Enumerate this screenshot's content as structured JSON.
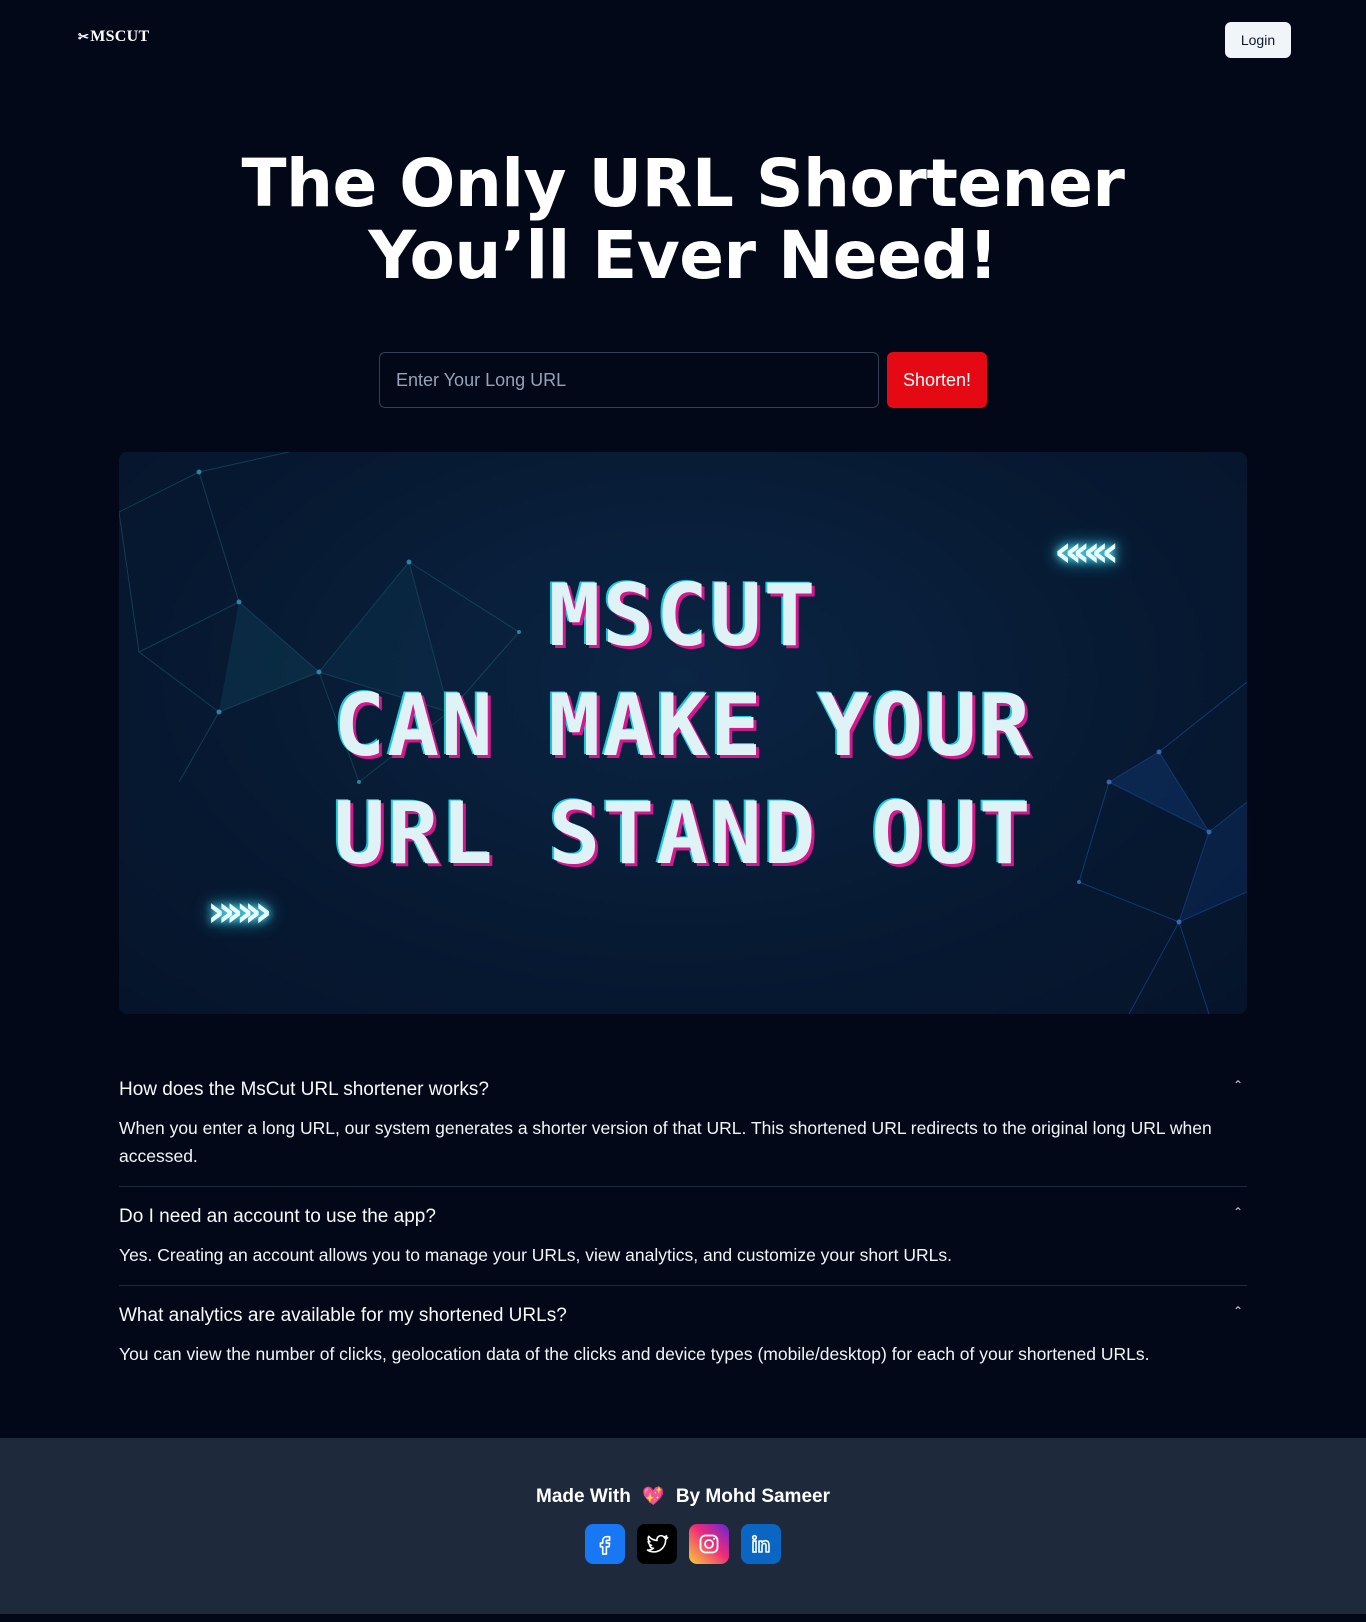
{
  "header": {
    "logo_icon": "scissors-icon",
    "logo_text": "MSCUT",
    "login_label": "Login"
  },
  "hero": {
    "title_line1": "The Only URL Shortener",
    "title_line2": "You’ll Ever Need!"
  },
  "shorten": {
    "placeholder": "Enter Your Long URL",
    "value": "",
    "button_label": "Shorten!"
  },
  "banner": {
    "line1": "MSCUT",
    "line2": "CAN MAKE YOUR",
    "line3": "URL STAND OUT",
    "chevrons_left": "«««",
    "chevrons_right": "»»»"
  },
  "faq": [
    {
      "question": "How does the MsCut URL shortener works?",
      "answer": "When you enter a long URL, our system generates a shorter version of that URL. This shortened URL redirects to the original long URL when accessed."
    },
    {
      "question": "Do I need an account to use the app?",
      "answer": "Yes. Creating an account allows you to manage your URLs, view analytics, and customize your short URLs."
    },
    {
      "question": "What analytics are available for my shortened URLs?",
      "answer": "You can view the number of clicks, geolocation data of the clicks and device types (mobile/desktop) for each of your shortened URLs."
    }
  ],
  "footer": {
    "made_with": "Made With",
    "by": "By Mohd Sameer",
    "socials": [
      "facebook-icon",
      "twitter-icon",
      "instagram-icon",
      "linkedin-icon"
    ]
  },
  "colors": {
    "background": "#020817",
    "accent": "#e50914",
    "footer_bg": "#1e293b"
  }
}
